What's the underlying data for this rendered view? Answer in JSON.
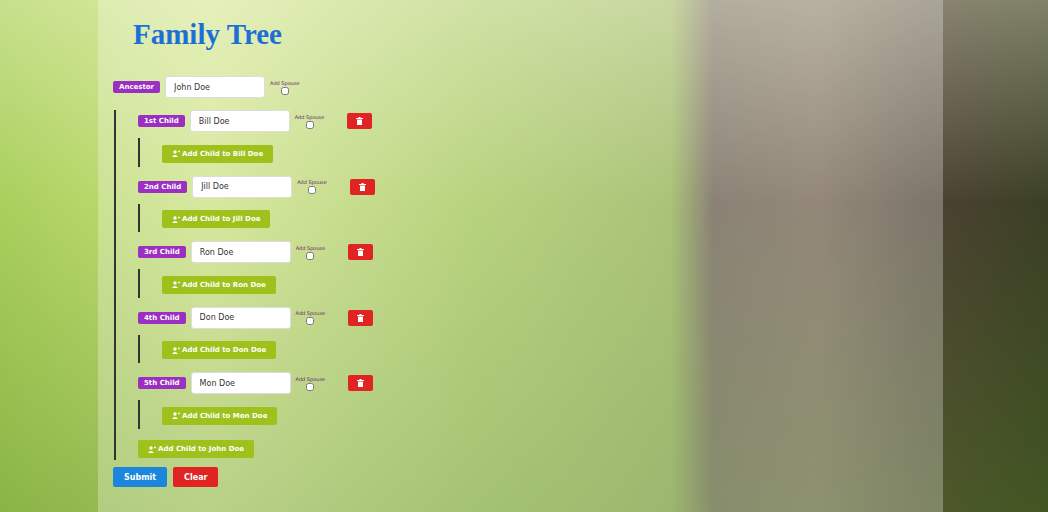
{
  "title": "Family Tree",
  "ancestor": {
    "label": "Ancestor",
    "name": "John Doe",
    "spouse_label": "Add Spouse",
    "spouse": false
  },
  "children": [
    {
      "label": "1st Child",
      "name": "Bill Doe",
      "spouse_label": "Add Spouse",
      "spouse": false,
      "add_child": "Add Child to Bill Doe"
    },
    {
      "label": "2nd Child",
      "name": "Jill Doe",
      "spouse_label": "Add Spouse",
      "spouse": false,
      "add_child": "Add Child to Jill Doe"
    },
    {
      "label": "3rd Child",
      "name": "Ron Doe",
      "spouse_label": "Add Spouse",
      "spouse": false,
      "add_child": "Add Child to Ron Doe"
    },
    {
      "label": "4th Child",
      "name": "Don Doe",
      "spouse_label": "Add Spouse",
      "spouse": false,
      "add_child": "Add Child to Don Doe"
    },
    {
      "label": "5th Child",
      "name": "Mon Doe",
      "spouse_label": "Add Spouse",
      "spouse": false,
      "add_child": "Add Child to Mon Doe"
    }
  ],
  "add_child": "Add Child to John Doe",
  "buttons": {
    "submit": "Submit",
    "clear": "Clear"
  }
}
